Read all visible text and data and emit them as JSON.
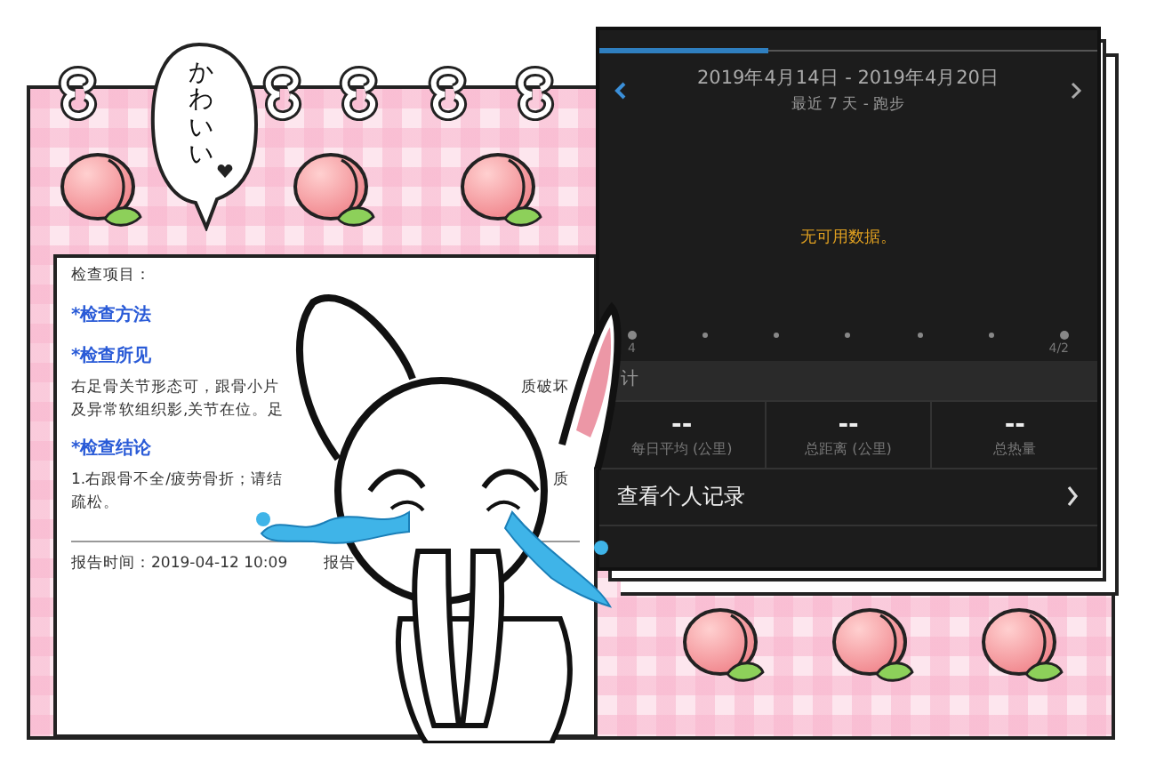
{
  "speech_bubble": {
    "text": "かわいい"
  },
  "report": {
    "lines": [
      {
        "kind": "label",
        "text": "检查项目："
      },
      {
        "kind": "heading",
        "text": "*检查方法"
      },
      {
        "kind": "heading",
        "text": "*检查所见"
      },
      {
        "kind": "split",
        "left": "右足骨关节形态可，跟骨小片",
        "right": "质破坏"
      },
      {
        "kind": "split",
        "left": "及异常软组织影,关节在位。足"
      },
      {
        "kind": "heading",
        "text": "*检查结论"
      },
      {
        "kind": "split",
        "left": "1.右跟骨不全/疲劳骨折；请结",
        "right": "质"
      },
      {
        "kind": "split",
        "left": "疏松。"
      }
    ],
    "footer": {
      "time": "报告时间：2019-04-12 10:09",
      "right": "报告"
    }
  },
  "activity": {
    "progress": {
      "level": 0.34
    },
    "date_range": "2019年4月14日 - 2019年4月20日",
    "subtitle": "最近 7 天 - 跑步",
    "empty_message": "无可用数据。",
    "axis_labels": [
      "4",
      "4/2"
    ],
    "section_header": "计",
    "stats": [
      {
        "value": "--",
        "label": "每日平均 (公里)"
      },
      {
        "value": "--",
        "label": "总距离 (公里)"
      },
      {
        "value": "--",
        "label": "总热量"
      }
    ],
    "records_link": "查看个人记录"
  }
}
